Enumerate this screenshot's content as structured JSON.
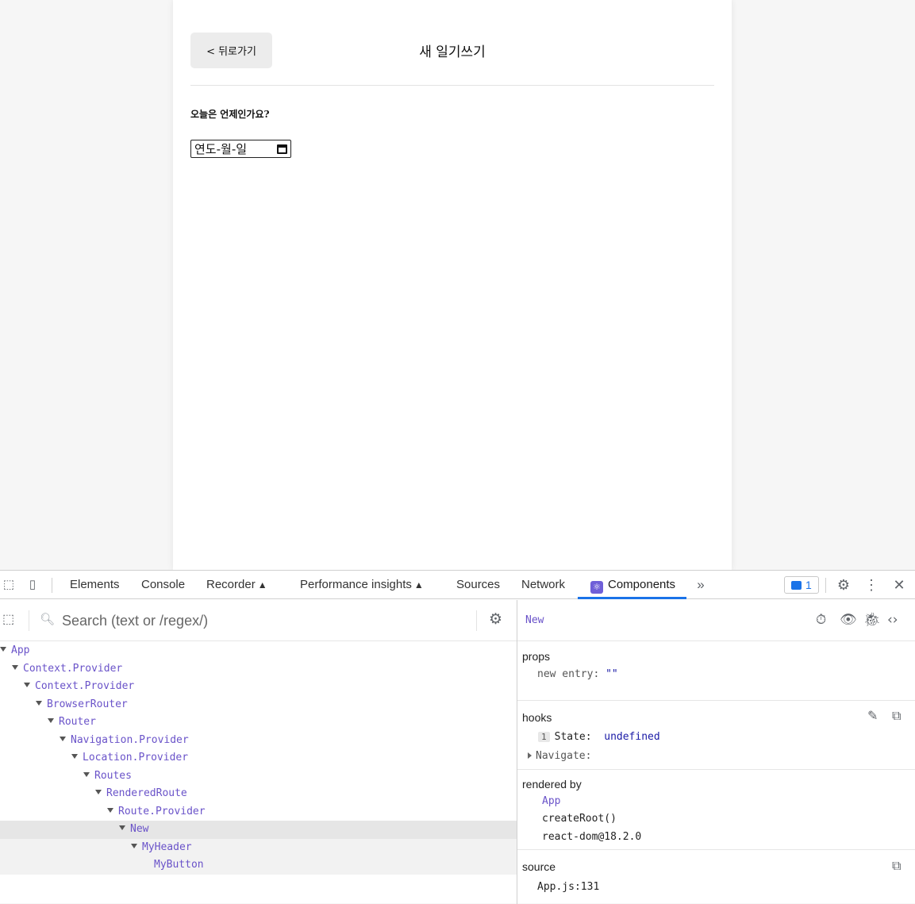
{
  "app": {
    "back_label": "< 뒤로가기",
    "title": "새 일기쓰기",
    "question": "오늘은 언제인가요?",
    "date_value": "연도-월-일"
  },
  "devtools": {
    "tabs": [
      "Elements",
      "Console",
      "Recorder",
      "Performance insights",
      "Sources",
      "Network",
      "Components"
    ],
    "active_tab": "Components",
    "flask_icon": "▲",
    "issues_count": "1",
    "search_placeholder": "Search (text or /regex/)",
    "tree": [
      {
        "label": "App",
        "depth": 0,
        "expanded": true
      },
      {
        "label": "Context.Provider",
        "depth": 1,
        "expanded": true
      },
      {
        "label": "Context.Provider",
        "depth": 2,
        "expanded": true
      },
      {
        "label": "BrowserRouter",
        "depth": 3,
        "expanded": true
      },
      {
        "label": "Router",
        "depth": 4,
        "expanded": true
      },
      {
        "label": "Navigation.Provider",
        "depth": 5,
        "expanded": true
      },
      {
        "label": "Location.Provider",
        "depth": 6,
        "expanded": true
      },
      {
        "label": "Routes",
        "depth": 7,
        "expanded": true
      },
      {
        "label": "RenderedRoute",
        "depth": 8,
        "expanded": true
      },
      {
        "label": "Route.Provider",
        "depth": 9,
        "expanded": true
      },
      {
        "label": "New",
        "depth": 10,
        "expanded": true,
        "selected": true
      },
      {
        "label": "MyHeader",
        "depth": 11,
        "expanded": true,
        "sub": true
      },
      {
        "label": "MyButton",
        "depth": 12,
        "expanded": false,
        "sub": true
      }
    ],
    "side": {
      "component_name": "New",
      "props_title": "props",
      "props_key": "new entry:",
      "props_value": "\"\"",
      "hooks_title": "hooks",
      "hook1_index": "1",
      "hook1_key": "State:",
      "hook1_value": "undefined",
      "hook2_key": "Navigate:",
      "rendered_by_title": "rendered by",
      "rendered_by": [
        "App",
        "createRoot()",
        "react-dom@18.2.0"
      ],
      "source_title": "source",
      "source_value": "App.js:131"
    },
    "colors": {
      "component": "#6a53c9",
      "accent": "#1a73e8",
      "value": "#1a1aa6"
    }
  }
}
